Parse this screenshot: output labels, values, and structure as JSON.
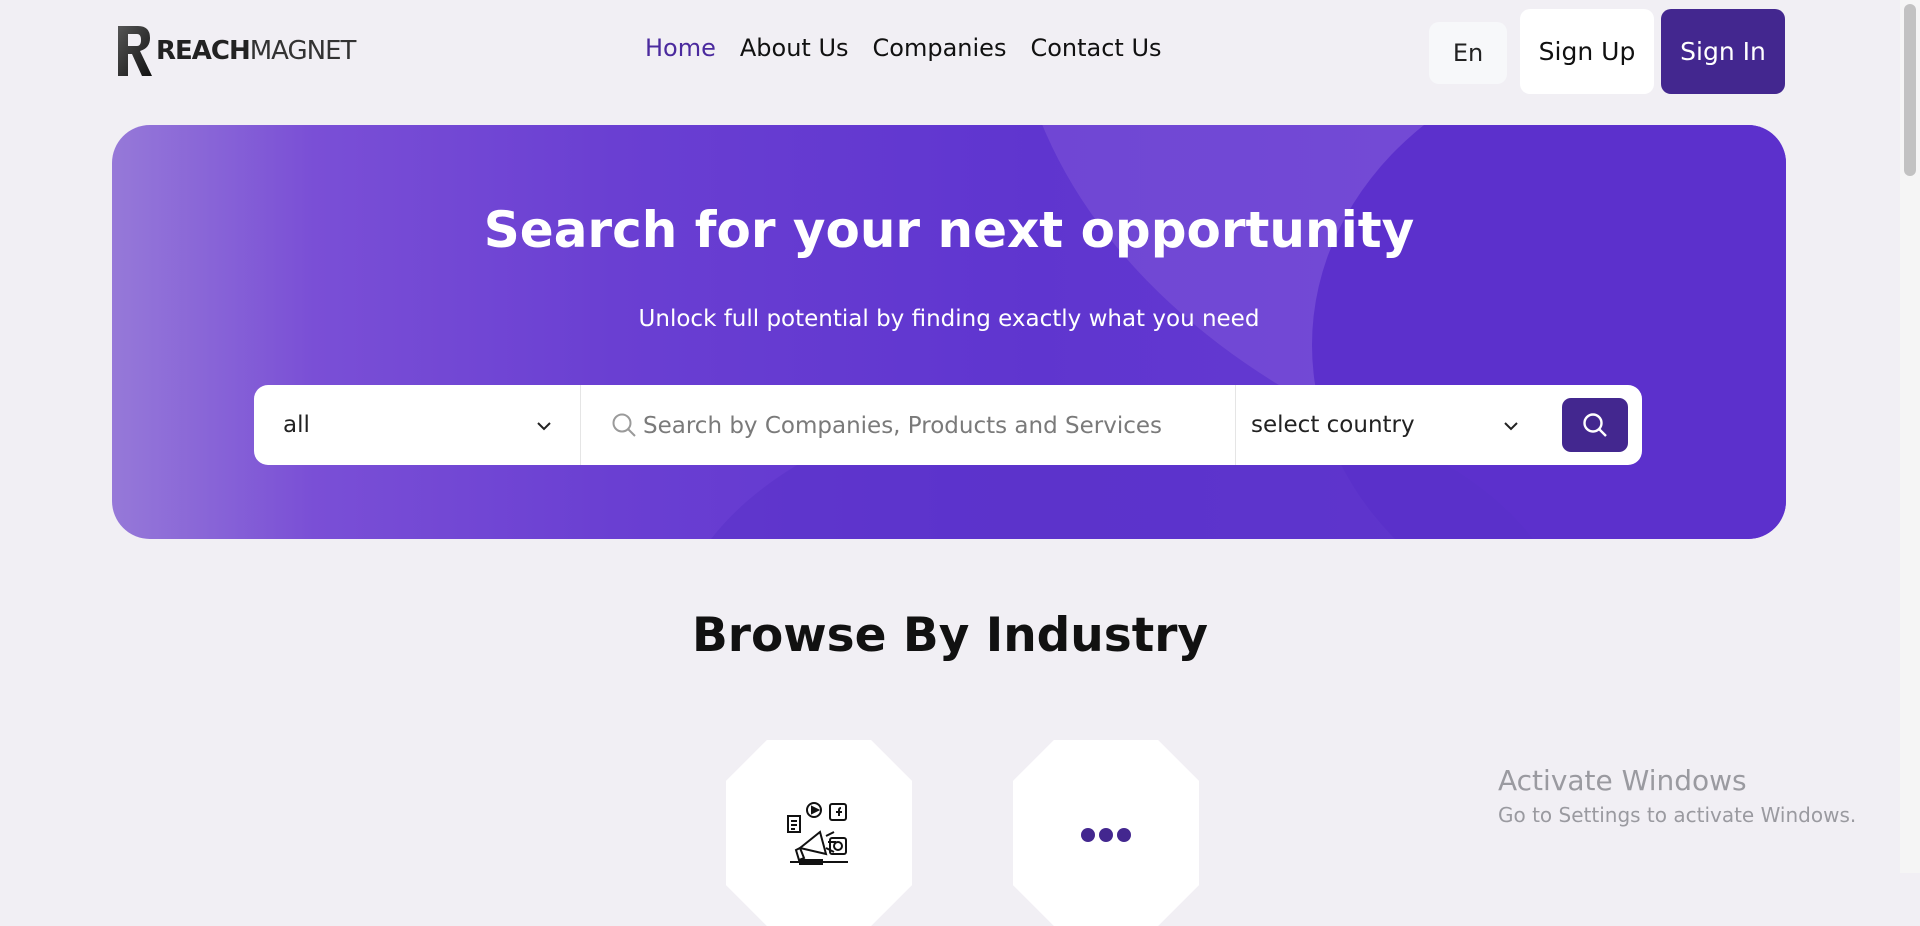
{
  "brand": {
    "logo_bold": "REACH",
    "logo_light": "MAGNET"
  },
  "nav": {
    "items": [
      {
        "label": "Home",
        "active": true
      },
      {
        "label": "About Us"
      },
      {
        "label": "Companies"
      },
      {
        "label": "Contact Us"
      }
    ]
  },
  "header": {
    "lang_label": "En",
    "signup_label": "Sign Up",
    "signin_label": "Sign In"
  },
  "hero": {
    "title": "Search for your next opportunity",
    "subtitle": "Unlock full potential by finding exactly what you need",
    "category_value": "all",
    "search_placeholder": "Search by Companies, Products and Services",
    "country_placeholder": "select country"
  },
  "browse": {
    "title": "Browse By Industry"
  },
  "os_overlay": {
    "line1": "Activate Windows",
    "line2": "Go to Settings to activate Windows."
  },
  "colors": {
    "accent": "#43278f",
    "active_nav": "#4b2a9e",
    "hero_mid": "#5f35cf",
    "page_bg": "#f1eff4"
  },
  "icons": [
    "reachmagnet-logo-mark",
    "chevron-down-icon",
    "search-icon",
    "marketing-megaphone-icon",
    "more-dots-icon"
  ]
}
